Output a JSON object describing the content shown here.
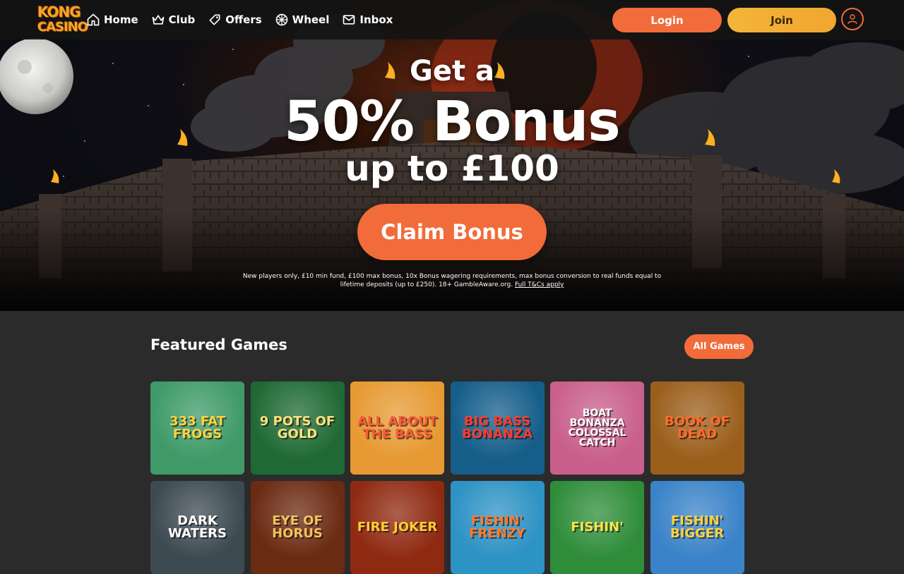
{
  "brand": {
    "logo_line1": "KONG",
    "logo_line2": "CASINO"
  },
  "nav": [
    {
      "label": "Home",
      "icon": "home-icon"
    },
    {
      "label": "Club",
      "icon": "crown-icon"
    },
    {
      "label": "Offers",
      "icon": "tag-icon"
    },
    {
      "label": "Wheel",
      "icon": "wheel-icon"
    },
    {
      "label": "Inbox",
      "icon": "mail-icon"
    }
  ],
  "header": {
    "login_label": "Login",
    "join_label": "Join",
    "user_icon": "user-icon"
  },
  "hero": {
    "line1": "Get a",
    "line2": "50% Bonus",
    "line3": "up to £100",
    "cta_label": "Claim Bonus",
    "terms_text": "New players only, £10 min fund, £100 max bonus, 10x Bonus wagering requirements, max bonus conversion to real funds equal to lifetime deposits (up to £250). 18+ GambleAware.org.",
    "terms_link": "Full T&Cs apply"
  },
  "featured": {
    "title": "Featured Games",
    "all_label": "All Games",
    "games": [
      {
        "name": "333 FAT FROGS",
        "bg": "#3f9a68"
      },
      {
        "name": "9 POTS OF GOLD",
        "bg": "#1f6a34"
      },
      {
        "name": "ALL ABOUT THE BASS",
        "bg": "#e79a33"
      },
      {
        "name": "BIG BASS BONANZA",
        "bg": "#155e8a"
      },
      {
        "name": "BOAT BONANZA COLOSSAL CATCH",
        "bg": "#c9608c"
      },
      {
        "name": "BOOK OF DEAD",
        "bg": "#9b5f1c"
      },
      {
        "name": "DARK WATERS",
        "bg": "#3d4a52"
      },
      {
        "name": "EYE OF HORUS",
        "bg": "#6b2a12"
      },
      {
        "name": "FIRE JOKER",
        "bg": "#8f2a12"
      },
      {
        "name": "FISHIN' FRENZY",
        "bg": "#2d92c4"
      },
      {
        "name": "FISHIN'",
        "bg": "#2f8d3a"
      },
      {
        "name": "FISHIN' BIGGER",
        "bg": "#3a83c8"
      }
    ]
  },
  "colors": {
    "accent": "#f26b3a",
    "join": "#f4b43a",
    "page_bg": "#2b2b2b"
  }
}
